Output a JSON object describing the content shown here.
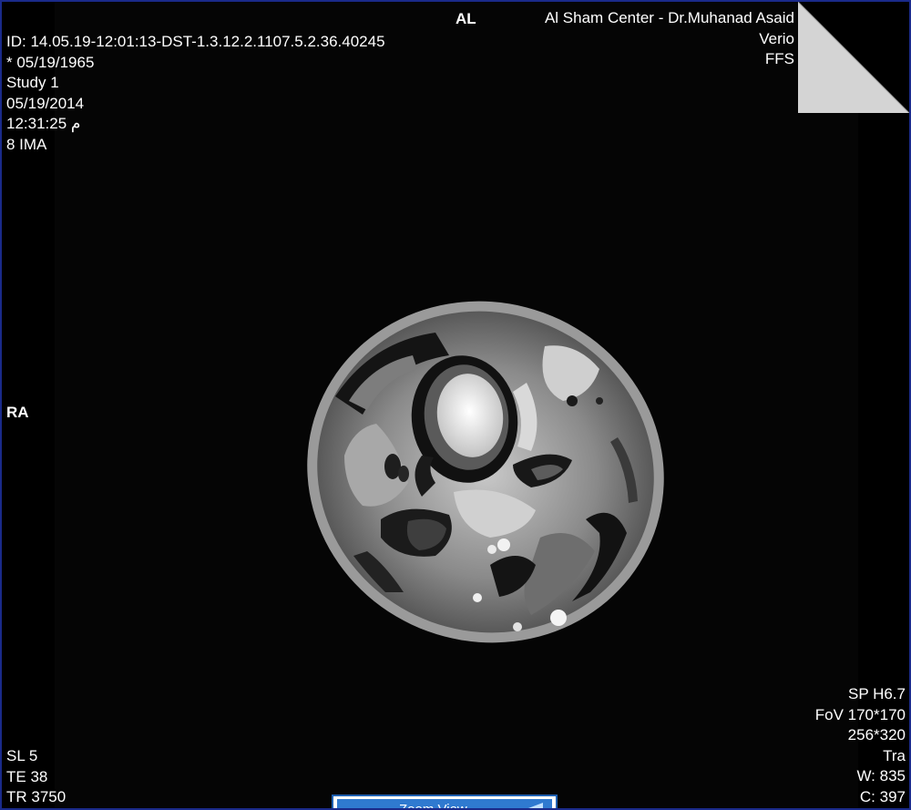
{
  "header": {
    "orientation_top": "AL",
    "orientation_left": "RA",
    "info_left": [
      "ID: 14.05.19-12:01:13-DST-1.3.12.2.1107.5.2.36.40245",
      "* 05/19/1965",
      "Study 1",
      "05/19/2014",
      "12:31:25 م",
      "8 IMA"
    ],
    "info_right": [
      "Al Sham Center - Dr.Muhanad Asaid",
      "Verio",
      "FFS"
    ]
  },
  "footer": {
    "info_left": [
      "SL 5",
      "TE 38",
      "TR 3750"
    ],
    "info_right": [
      "SP H6.7",
      "FoV 170*170",
      "256*320",
      "Tra",
      "W: 835",
      "C: 397"
    ]
  },
  "toolbar": {
    "zoom_label": "Zoom View",
    "accent_color": "#2f7ad0"
  },
  "icons": {
    "corner": "page-corner-fold-icon",
    "zoom": "arrow-icon"
  }
}
